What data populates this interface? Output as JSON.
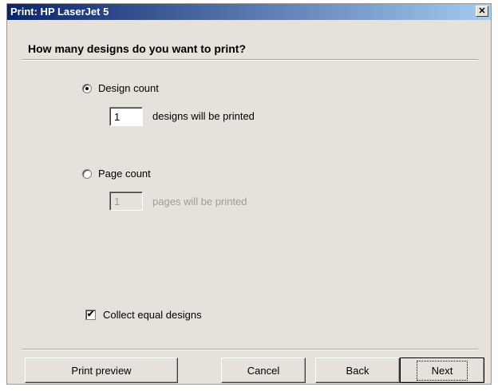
{
  "window": {
    "title": "Print: HP LaserJet 5",
    "close_glyph": "✕"
  },
  "header": {
    "question": "How many designs do you want to print?"
  },
  "options": {
    "design_count": {
      "label": "Design count",
      "selected": true,
      "value": "1",
      "suffix": "designs will be printed"
    },
    "page_count": {
      "label": "Page count",
      "selected": false,
      "value": "1",
      "suffix": "pages will be printed"
    }
  },
  "collect": {
    "label": "Collect equal designs",
    "checked": true,
    "check_glyph": "✔"
  },
  "buttons": {
    "print_preview": "Print preview",
    "cancel": "Cancel",
    "back": "Back",
    "next": "Next"
  }
}
